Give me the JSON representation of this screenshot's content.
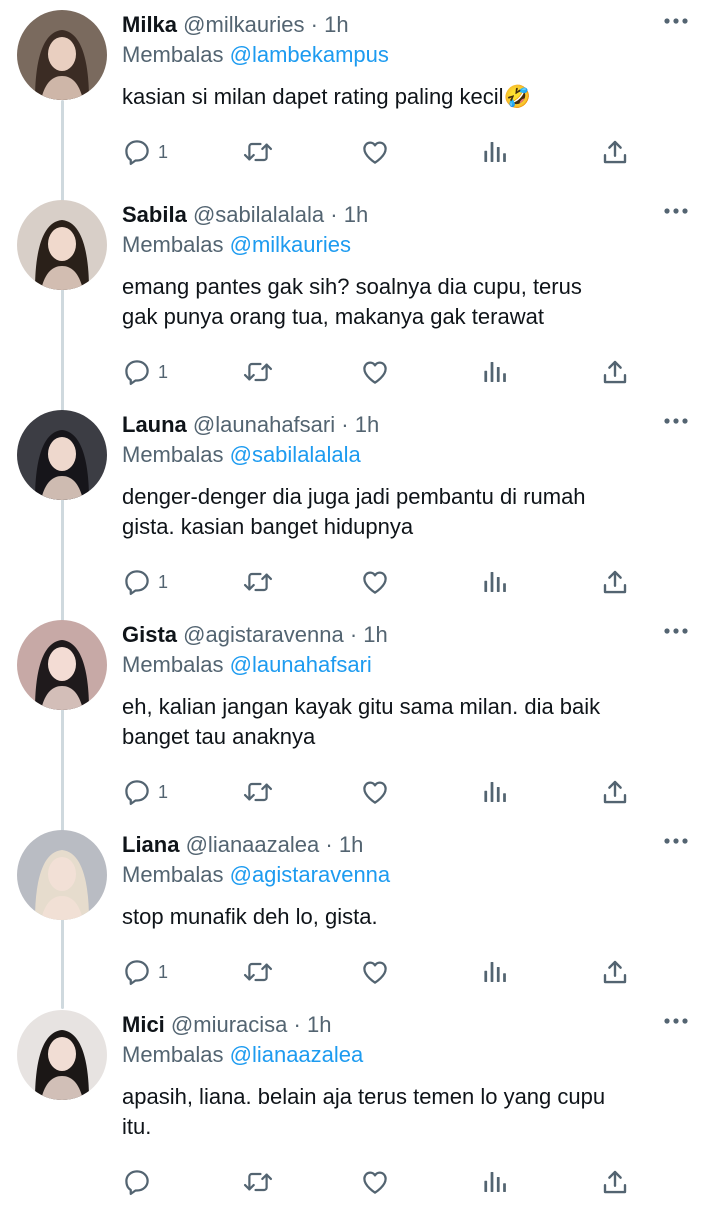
{
  "colors": {
    "text": "#0f1419",
    "secondary": "#536471",
    "link": "#1d9bf0",
    "thread": "#cfd9de"
  },
  "tweets": [
    {
      "name": "Milka",
      "handle": "@milkauries",
      "dot": "·",
      "time": "1h",
      "replying_label": "Membalas",
      "replying_to": "@lambekampus",
      "lines": [
        "kasian si milan dapet rating paling kecil🤣"
      ],
      "reply_count": "1",
      "avatar_bg": "#7a6a5e",
      "avatar_hair": "#3b2c24",
      "avatar_skin": "#e9cfc0"
    },
    {
      "name": "Sabila",
      "handle": "@sabilalalala",
      "dot": "·",
      "time": "1h",
      "replying_label": "Membalas",
      "replying_to": "@milkauries",
      "lines": [
        "emang pantes gak sih? soalnya dia cupu, terus",
        "gak punya orang tua, makanya gak terawat"
      ],
      "reply_count": "1",
      "avatar_bg": "#d8cfc8",
      "avatar_hair": "#2a2019",
      "avatar_skin": "#f0d9cc"
    },
    {
      "name": "Launa",
      "handle": "@launahafsari",
      "dot": "·",
      "time": "1h",
      "replying_label": "Membalas",
      "replying_to": "@sabilalalala",
      "lines": [
        "denger-denger dia juga jadi pembantu di rumah",
        "gista. kasian banget hidupnya"
      ],
      "reply_count": "1",
      "avatar_bg": "#3c3d44",
      "avatar_hair": "#16151a",
      "avatar_skin": "#eed8cd"
    },
    {
      "name": "Gista",
      "handle": "@agistaravenna",
      "dot": "·",
      "time": "1h",
      "replying_label": "Membalas",
      "replying_to": "@launahafsari",
      "lines": [
        "eh, kalian jangan kayak gitu sama milan. dia baik",
        "banget tau anaknya"
      ],
      "reply_count": "1",
      "avatar_bg": "#c7a9a6",
      "avatar_hair": "#1f1a1c",
      "avatar_skin": "#f3dcd4"
    },
    {
      "name": "Liana",
      "handle": "@lianaazalea",
      "dot": "·",
      "time": "1h",
      "replying_label": "Membalas",
      "replying_to": "@agistaravenna",
      "lines": [
        "stop munafik deh lo, gista."
      ],
      "reply_count": "1",
      "avatar_bg": "#b9bcc3",
      "avatar_hair": "#e6dccd",
      "avatar_skin": "#f2e0d6"
    },
    {
      "name": "Mici",
      "handle": "@miuracisa",
      "dot": "·",
      "time": "1h",
      "replying_label": "Membalas",
      "replying_to": "@lianaazalea",
      "lines": [
        "apasih, liana. belain aja terus temen lo yang cupu",
        "itu."
      ],
      "reply_count": "",
      "avatar_bg": "#e7e3e1",
      "avatar_hair": "#1b1716",
      "avatar_skin": "#f1ddd4"
    }
  ]
}
